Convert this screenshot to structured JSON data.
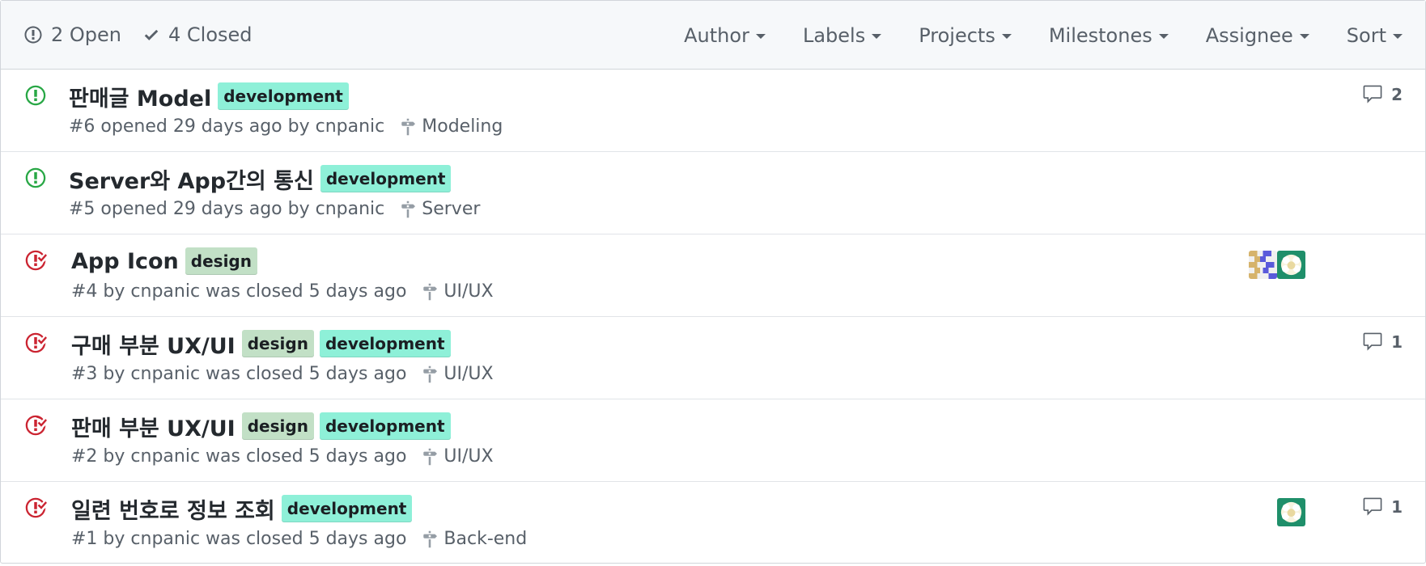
{
  "header": {
    "open_label": "2 Open",
    "closed_label": "4 Closed",
    "filters": [
      "Author",
      "Labels",
      "Projects",
      "Milestones",
      "Assignee",
      "Sort"
    ]
  },
  "issues": [
    {
      "state": "open",
      "title": "판매글 Model",
      "labels": [
        "development"
      ],
      "meta": "#6 opened 29 days ago by cnpanic",
      "milestone": "Modeling",
      "comments": "2"
    },
    {
      "state": "open",
      "title": "Server와 App간의 통신",
      "labels": [
        "development"
      ],
      "meta": "#5 opened 29 days ago by cnpanic",
      "milestone": "Server",
      "comments": ""
    },
    {
      "state": "closed",
      "title": "App Icon",
      "labels": [
        "design"
      ],
      "meta": "#4 by cnpanic was closed 5 days ago",
      "milestone": "UI/UX",
      "comments": ""
    },
    {
      "state": "closed",
      "title": "구매 부분 UX/UI",
      "labels": [
        "design",
        "development"
      ],
      "meta": "#3 by cnpanic was closed 5 days ago",
      "milestone": "UI/UX",
      "comments": "1"
    },
    {
      "state": "closed",
      "title": "판매 부분 UX/UI",
      "labels": [
        "design",
        "development"
      ],
      "meta": "#2 by cnpanic was closed 5 days ago",
      "milestone": "UI/UX",
      "comments": ""
    },
    {
      "state": "closed",
      "title": "일련 번호로 정보 조회",
      "labels": [
        "development"
      ],
      "meta": "#1 by cnpanic was closed 5 days ago",
      "milestone": "Back-end",
      "comments": "1"
    }
  ],
  "colors": {
    "open": "#28a745",
    "closed": "#cb2431",
    "development_label": "#8ef0d8",
    "design_label": "#c2e0c6"
  }
}
